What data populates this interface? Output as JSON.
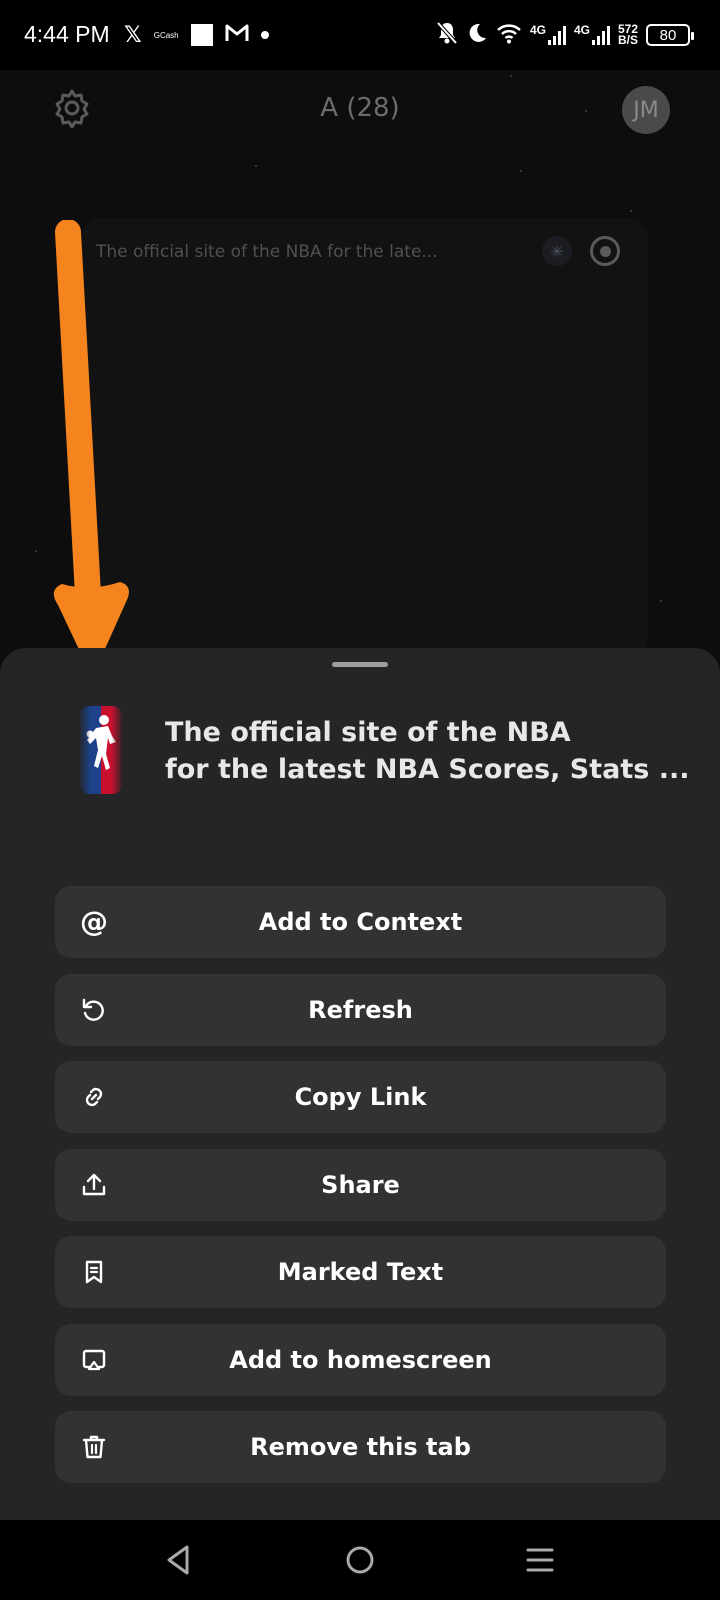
{
  "status_bar": {
    "time": "4:44 PM",
    "left_icons": [
      "x-icon",
      "gcash-icon",
      "square-icon",
      "gmail-icon",
      "dot-icon"
    ],
    "gcash_label": "GCash",
    "network_1": "4G",
    "network_2": "4G",
    "speed_value": "572",
    "speed_unit": "B/S",
    "battery": "80"
  },
  "app": {
    "title": "A (28)",
    "avatar_initials": "JM",
    "tab_card_title": "The official site of the NBA for the late..."
  },
  "sheet": {
    "page_title_line1": "The official site of the NBA",
    "page_title_line2": "for the latest NBA Scores, Stats ...",
    "actions": [
      {
        "label": "Add to Context",
        "icon": "at-icon"
      },
      {
        "label": "Refresh",
        "icon": "refresh-icon"
      },
      {
        "label": "Copy Link",
        "icon": "link-icon"
      },
      {
        "label": "Share",
        "icon": "share-icon"
      },
      {
        "label": "Marked Text",
        "icon": "bookmark-icon"
      },
      {
        "label": "Add to homescreen",
        "icon": "homescreen-icon"
      },
      {
        "label": "Remove this tab",
        "icon": "trash-icon"
      }
    ]
  },
  "nav_bar": {
    "buttons": [
      "back-icon",
      "home-icon",
      "recents-icon"
    ]
  },
  "colors": {
    "sheet_bg": "#252527",
    "button_bg": "#323234",
    "annotation_arrow": "#f5841f"
  }
}
